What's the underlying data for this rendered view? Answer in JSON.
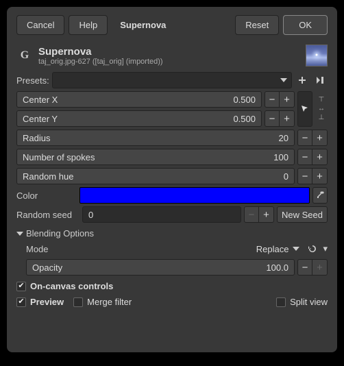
{
  "buttons": {
    "cancel": "Cancel",
    "help": "Help",
    "reset": "Reset",
    "ok": "OK"
  },
  "title_inline": "Supernova",
  "header": {
    "name": "Supernova",
    "sub": "taj_orig.jpg-627 ([taj_orig] (imported))"
  },
  "presets_label": "Presets:",
  "fields": {
    "centerx": {
      "label": "Center X",
      "value": "0.500"
    },
    "centery": {
      "label": "Center Y",
      "value": "0.500"
    },
    "radius": {
      "label": "Radius",
      "value": "20"
    },
    "spokes": {
      "label": "Number of spokes",
      "value": "100"
    },
    "randhue": {
      "label": "Random hue",
      "value": "0"
    }
  },
  "color_label": "Color",
  "color_value": "#0000ff",
  "seed": {
    "label": "Random seed",
    "value": "0",
    "newseed": "New Seed"
  },
  "blending": {
    "title": "Blending Options",
    "mode_label": "Mode",
    "mode_value": "Replace",
    "opacity_label": "Opacity",
    "opacity_value": "100.0"
  },
  "checks": {
    "oncanvas": "On-canvas controls",
    "preview": "Preview",
    "merge": "Merge filter",
    "split": "Split view"
  }
}
